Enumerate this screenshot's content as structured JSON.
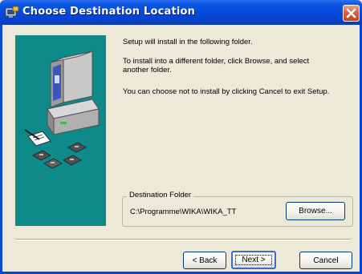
{
  "window": {
    "title": "Choose Destination Location",
    "close_icon": "close-x-icon",
    "app_icon": "installer-icon",
    "titlebar_color": "#0547d8",
    "panel_color": "#0e8a8a"
  },
  "messages": {
    "line1": "Setup will install  in the following folder.",
    "line2a": "To install into a different folder, click Browse, and select",
    "line2b": "another folder.",
    "line3": "You can choose not to install  by clicking Cancel to exit Setup."
  },
  "destination": {
    "group_label": "Destination Folder",
    "path": "C:\\Programme\\WIKA\\WIKA_TT",
    "browse_label": "Browse..."
  },
  "buttons": {
    "back_label": "< Back",
    "next_label": "Next >",
    "cancel_label": "Cancel"
  },
  "illustration": {
    "icons": [
      "computer-icon",
      "floppy-disk-icon"
    ]
  }
}
